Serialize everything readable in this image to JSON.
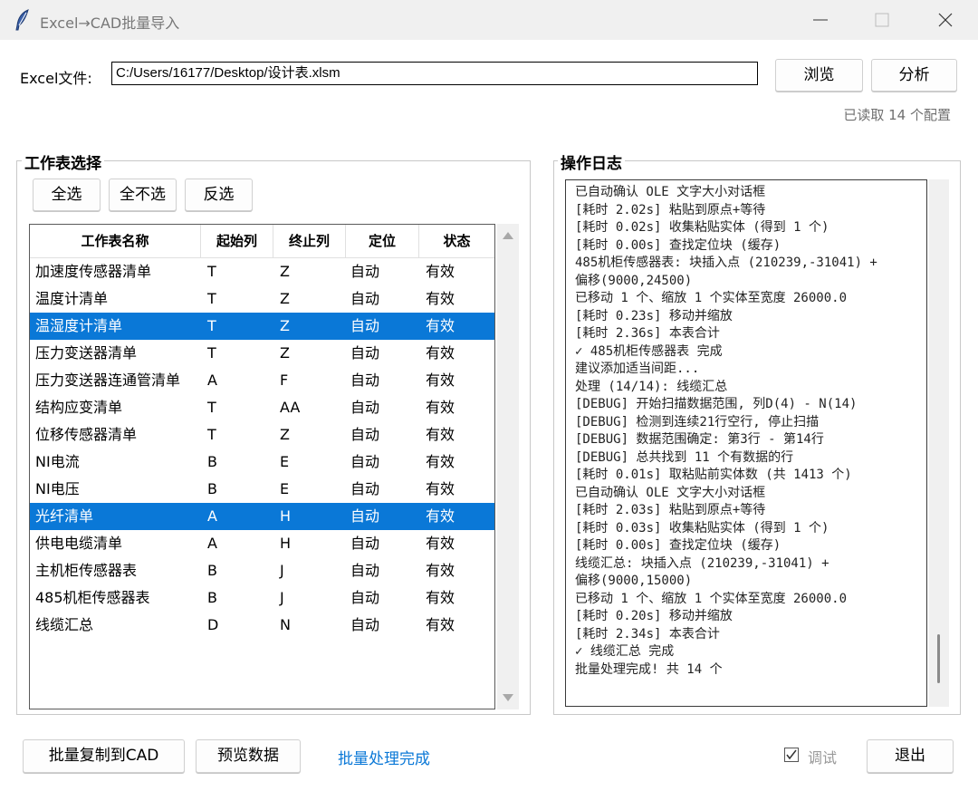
{
  "window": {
    "title": "Excel→CAD批量导入",
    "minimize_icon": "minimize-icon",
    "maximize_icon": "maximize-icon",
    "close_icon": "close-icon"
  },
  "file": {
    "label": "Excel文件:",
    "path": "C:/Users/16177/Desktop/设计表.xlsm",
    "browse_label": "浏览",
    "analyze_label": "分析",
    "status": "已读取 14 个配置"
  },
  "sheets": {
    "group_title": "工作表选择",
    "select_all": "全选",
    "select_none": "全不选",
    "invert": "反选",
    "columns": [
      "工作表名称",
      "起始列",
      "终止列",
      "定位",
      "状态"
    ],
    "rows": [
      {
        "name": "加速度传感器清单",
        "start": "T",
        "end": "Z",
        "locate": "自动",
        "status": "有效",
        "selected": false
      },
      {
        "name": "温度计清单",
        "start": "T",
        "end": "Z",
        "locate": "自动",
        "status": "有效",
        "selected": false
      },
      {
        "name": "温湿度计清单",
        "start": "T",
        "end": "Z",
        "locate": "自动",
        "status": "有效",
        "selected": true
      },
      {
        "name": "压力变送器清单",
        "start": "T",
        "end": "Z",
        "locate": "自动",
        "status": "有效",
        "selected": false
      },
      {
        "name": "压力变送器连通管清单",
        "start": "A",
        "end": "F",
        "locate": "自动",
        "status": "有效",
        "selected": false
      },
      {
        "name": "结构应变清单",
        "start": "T",
        "end": "AA",
        "locate": "自动",
        "status": "有效",
        "selected": false
      },
      {
        "name": "位移传感器清单",
        "start": "T",
        "end": "Z",
        "locate": "自动",
        "status": "有效",
        "selected": false
      },
      {
        "name": "NI电流",
        "start": "B",
        "end": "E",
        "locate": "自动",
        "status": "有效",
        "selected": false
      },
      {
        "name": "NI电压",
        "start": "B",
        "end": "E",
        "locate": "自动",
        "status": "有效",
        "selected": false
      },
      {
        "name": "光纤清单",
        "start": "A",
        "end": "H",
        "locate": "自动",
        "status": "有效",
        "selected": true
      },
      {
        "name": "供电电缆清单",
        "start": "A",
        "end": "H",
        "locate": "自动",
        "status": "有效",
        "selected": false
      },
      {
        "name": "主机柜传感器表",
        "start": "B",
        "end": "J",
        "locate": "自动",
        "status": "有效",
        "selected": false
      },
      {
        "name": "485机柜传感器表",
        "start": "B",
        "end": "J",
        "locate": "自动",
        "status": "有效",
        "selected": false
      },
      {
        "name": "线缆汇总",
        "start": "D",
        "end": "N",
        "locate": "自动",
        "status": "有效",
        "selected": false
      }
    ]
  },
  "log": {
    "group_title": "操作日志",
    "lines": [
      "已自动确认 OLE 文字大小对话框",
      "[耗时 2.02s] 粘贴到原点+等待",
      "[耗时 0.02s] 收集粘贴实体 (得到 1 个)",
      "[耗时 0.00s] 查找定位块 (缓存)",
      "485机柜传感器表: 块插入点 (210239,-31041) +",
      "偏移(9000,24500)",
      "已移动 1 个、缩放 1 个实体至宽度 26000.0",
      "[耗时 0.23s] 移动并缩放",
      "[耗时 2.36s] 本表合计",
      "✓ 485机柜传感器表 完成",
      "建议添加适当间距...",
      "处理 (14/14): 线缆汇总",
      "[DEBUG] 开始扫描数据范围, 列D(4) - N(14)",
      "[DEBUG] 检测到连续21行空行, 停止扫描",
      "[DEBUG] 数据范围确定: 第3行 - 第14行",
      "[DEBUG] 总共找到 11 个有数据的行",
      "[耗时 0.01s] 取粘贴前实体数 (共 1413 个)",
      "已自动确认 OLE 文字大小对话框",
      "[耗时 2.03s] 粘贴到原点+等待",
      "[耗时 0.03s] 收集粘贴实体 (得到 1 个)",
      "[耗时 0.00s] 查找定位块 (缓存)",
      "线缆汇总: 块插入点 (210239,-31041) +",
      "偏移(9000,15000)",
      "已移动 1 个、缩放 1 个实体至宽度 26000.0",
      "[耗时 0.20s] 移动并缩放",
      "[耗时 2.34s] 本表合计",
      "✓ 线缆汇总 完成",
      "批量处理完成! 共 14 个"
    ]
  },
  "footer": {
    "batch_copy": "批量复制到CAD",
    "preview": "预览数据",
    "done_status": "批量处理完成",
    "debug_label": "调试",
    "debug_checked": true,
    "exit_label": "退出"
  }
}
